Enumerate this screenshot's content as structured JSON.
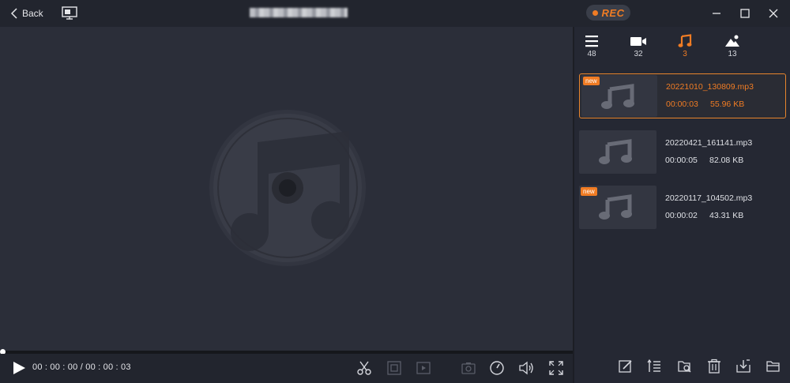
{
  "titlebar": {
    "back_label": "Back",
    "rec_label": "REC",
    "icons": [
      "chevron-left-icon",
      "monitor-icon",
      "minimize-icon",
      "maximize-icon",
      "close-icon"
    ]
  },
  "player": {
    "current_time": "00 : 00 : 00",
    "separator": "/",
    "total_time": "00 : 00 : 03",
    "progress": 0,
    "icons": [
      "play-icon",
      "scissors-icon",
      "crop-icon",
      "media-frame-icon",
      "camera-icon",
      "speed-icon",
      "volume-icon",
      "fullscreen-icon"
    ]
  },
  "sidebar": {
    "tabs": [
      {
        "icon": "list-icon",
        "count": "48",
        "active": false
      },
      {
        "icon": "video-camera-icon",
        "count": "32",
        "active": false
      },
      {
        "icon": "music-note-icon",
        "count": "3",
        "active": true
      },
      {
        "icon": "image-icon",
        "count": "13",
        "active": false
      }
    ],
    "items": [
      {
        "badge": "new",
        "name": "20221010_130809.mp3",
        "duration": "00:00:03",
        "size": "55.96 KB",
        "selected": true
      },
      {
        "badge": "",
        "name": "20220421_161141.mp3",
        "duration": "00:00:05",
        "size": "82.08 KB",
        "selected": false
      },
      {
        "badge": "new",
        "name": "20220117_104502.mp3",
        "duration": "00:00:02",
        "size": "43.31 KB",
        "selected": false
      }
    ],
    "footer_icons": [
      "edit-icon",
      "sort-icon",
      "search-folder-icon",
      "delete-icon",
      "export-icon",
      "open-folder-icon"
    ]
  },
  "colors": {
    "accent": "#f07c24",
    "background": "#2b2e39",
    "sidebar": "#252833"
  }
}
